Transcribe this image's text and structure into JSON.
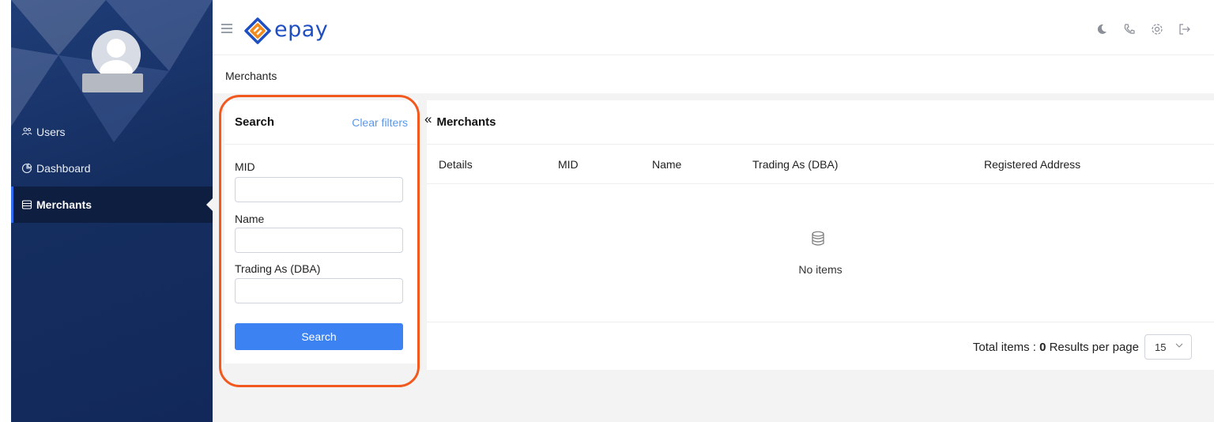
{
  "sidebar": {
    "items": [
      {
        "label": "Users",
        "icon": "users-icon"
      },
      {
        "label": "Dashboard",
        "icon": "dashboard-icon"
      },
      {
        "label": "Merchants",
        "icon": "merchants-icon"
      }
    ],
    "active": "Merchants"
  },
  "header": {
    "logo_text": "epay",
    "icons": [
      "moon-icon",
      "phone-icon",
      "gear-icon",
      "logout-icon"
    ]
  },
  "breadcrumb": "Merchants",
  "search_panel": {
    "title": "Search",
    "clear_label": "Clear filters",
    "fields": [
      {
        "label": "MID",
        "value": ""
      },
      {
        "label": "Name",
        "value": ""
      },
      {
        "label": "Trading As (DBA)",
        "value": ""
      }
    ],
    "button_label": "Search"
  },
  "merchants_panel": {
    "collapse_symbol": "«",
    "title": "Merchants",
    "columns": [
      "Details",
      "MID",
      "Name",
      "Trading As (DBA)",
      "Registered Address"
    ],
    "empty_text": "No items",
    "total_label": "Total items :",
    "total_value": "0",
    "per_page_label": "Results per page",
    "per_page_value": "15"
  },
  "colors": {
    "sidebar_bg": "#152e60",
    "brand_blue": "#1e4fc2",
    "button_blue": "#3d82f2",
    "highlight_orange": "#f2591e",
    "link_blue": "#5b97e8"
  }
}
